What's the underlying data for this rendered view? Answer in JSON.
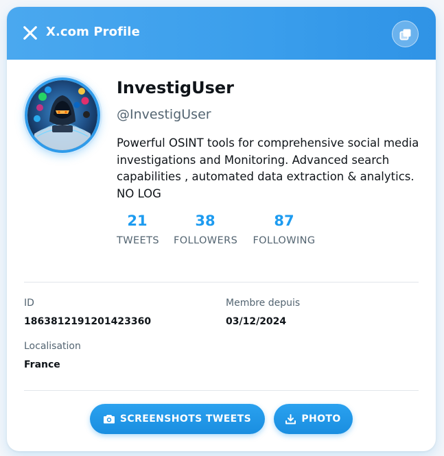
{
  "header": {
    "title": "X.com Profile",
    "logo_icon": "x-logo-icon",
    "copy_icon": "copy-icon"
  },
  "profile": {
    "display_name": "InvestigUser",
    "handle": "@InvestigUser",
    "bio": "Powerful OSINT tools for comprehensive social media investigations and Monitoring. Advanced search capabilities , automated data extraction & analytics. NO LOG"
  },
  "stats": [
    {
      "value": "21",
      "label": "TWEETS"
    },
    {
      "value": "38",
      "label": "FOLLOWERS"
    },
    {
      "value": "87",
      "label": "FOLLOWING"
    }
  ],
  "details": {
    "id_label": "ID",
    "id_value": "1863812191201423360",
    "member_since_label": "Membre depuis",
    "member_since_value": "03/12/2024",
    "location_label": "Localisation",
    "location_value": "France"
  },
  "actions": {
    "screenshots_label": "SCREENSHOTS TWEETS",
    "screenshots_icon": "camera-icon",
    "photo_label": "PHOTO",
    "photo_icon": "download-icon"
  },
  "colors": {
    "accent": "#1d9bf0",
    "header_gradient_start": "#4aa8ef",
    "header_gradient_end": "#2f93e6",
    "muted_text": "#536471"
  }
}
